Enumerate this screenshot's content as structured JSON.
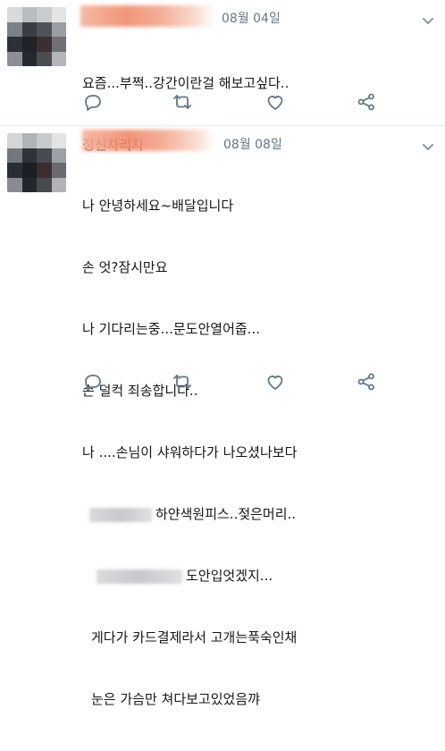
{
  "colors": {
    "text": "#14171a",
    "muted": "#657786",
    "icon": "#657786",
    "name_blur": "#f08a6c"
  },
  "tweets": [
    {
      "date": "08월 04일",
      "lines": [
        "요즘...부쩍..강간이란걸 해보고싶다..",
        "정신차리자"
      ],
      "icons": [
        "reply-icon",
        "retweet-icon",
        "like-icon",
        "share-icon"
      ]
    },
    {
      "date": "08월 08일",
      "lines": [
        "나 안녕하세요~배달입니다",
        "손 엇?잠시만요",
        "나 기다리는중...문도안열어줍...",
        "손 덜컥 죄송합니다..",
        "나 ....손님이 샤워하다가 나오셨나보다",
        "하얀색원피스..젖은머리..",
        "도안입엇겠지...",
        "게다가 카드결제라서 고개는푹숙인채",
        "눈은 가슴만 쳐다보고있었음꺄"
      ],
      "icons": [
        "reply-icon",
        "retweet-icon",
        "like-icon",
        "share-icon"
      ]
    }
  ]
}
